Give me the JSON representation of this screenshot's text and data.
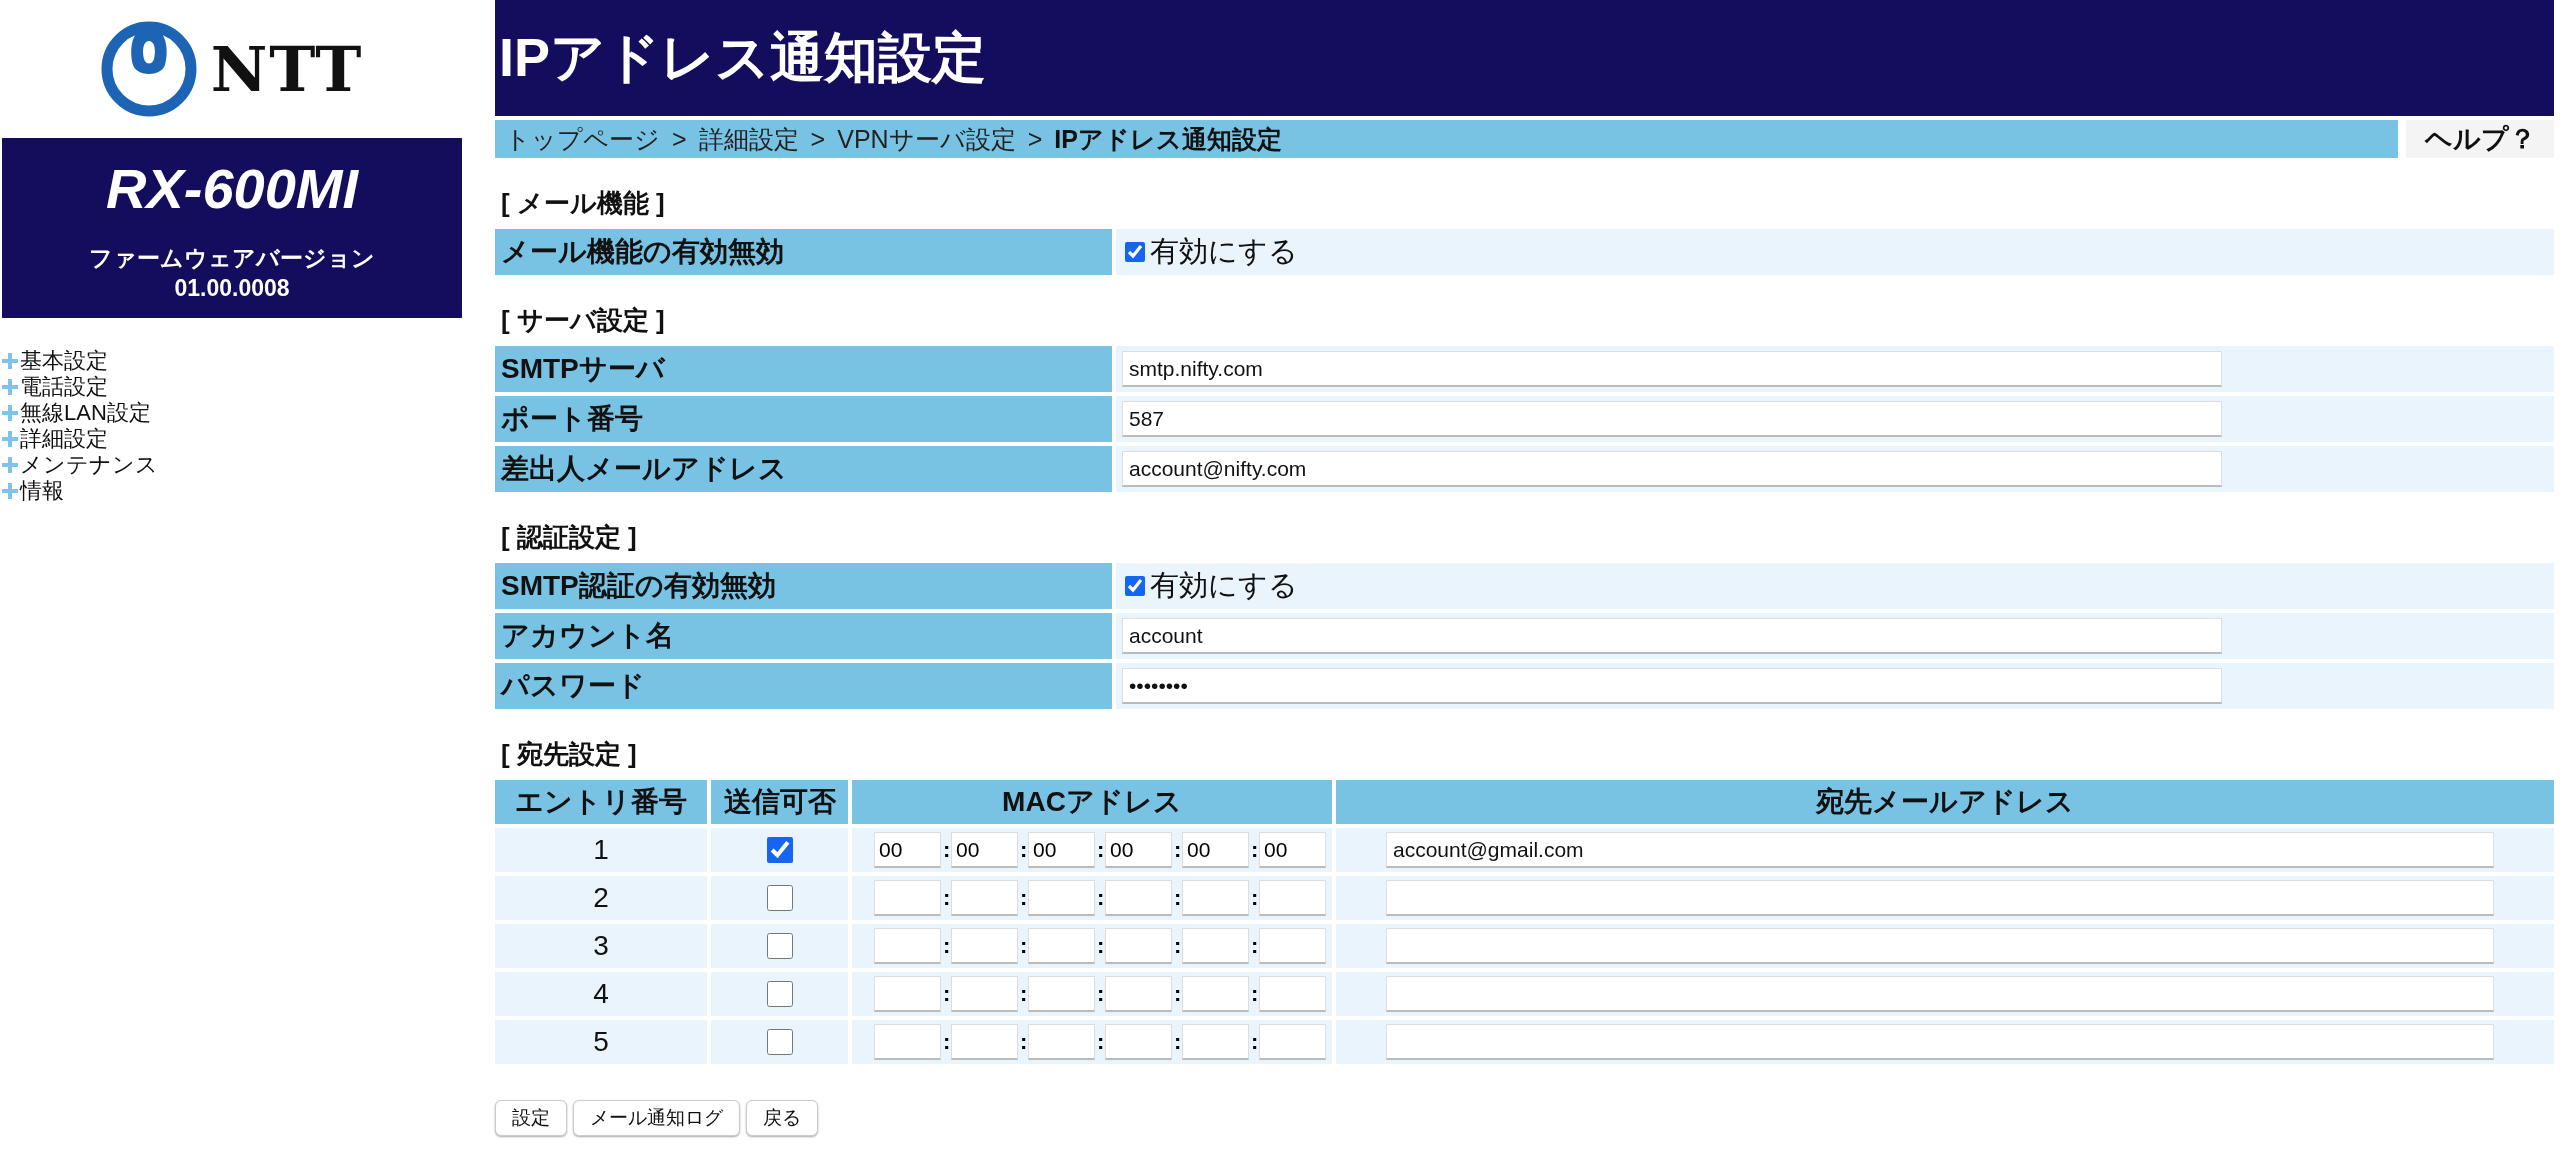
{
  "logo": {
    "text": "NTT"
  },
  "device": {
    "model": "RX-600MI",
    "firmware_label": "ファームウェアバージョン",
    "firmware_version": "01.00.0008"
  },
  "sidebar": {
    "items": [
      {
        "label": "基本設定"
      },
      {
        "label": "電話設定"
      },
      {
        "label": "無線LAN設定"
      },
      {
        "label": "詳細設定"
      },
      {
        "label": "メンテナンス"
      },
      {
        "label": "情報"
      }
    ]
  },
  "page_title": "IPアドレス通知設定",
  "breadcrumb": {
    "separator": ">",
    "items": [
      {
        "label": "トップページ",
        "current": false
      },
      {
        "label": "詳細設定",
        "current": false
      },
      {
        "label": "VPNサーバ設定",
        "current": false
      },
      {
        "label": "IPアドレス通知設定",
        "current": true
      }
    ]
  },
  "help_button": "ヘルプ？",
  "sections": [
    {
      "heading": "[ メール機能 ]",
      "rows": [
        {
          "kind": "checkbox",
          "label": "メール機能の有効無効",
          "checked": true,
          "option": "有効にする"
        }
      ]
    },
    {
      "heading": "[ サーバ設定 ]",
      "rows": [
        {
          "kind": "text",
          "label": "SMTPサーバ",
          "value": "smtp.nifty.com"
        },
        {
          "kind": "text",
          "label": "ポート番号",
          "value": "587"
        },
        {
          "kind": "text",
          "label": "差出人メールアドレス",
          "value": "account@nifty.com"
        }
      ]
    },
    {
      "heading": "[ 認証設定 ]",
      "rows": [
        {
          "kind": "checkbox",
          "label": "SMTP認証の有効無効",
          "checked": true,
          "option": "有効にする"
        },
        {
          "kind": "text",
          "label": "アカウント名",
          "value": "account"
        },
        {
          "kind": "password",
          "label": "パスワード",
          "value": "••••••••"
        }
      ]
    }
  ],
  "destinations": {
    "heading": "[ 宛先設定 ]",
    "columns": [
      "エントリ番号",
      "送信可否",
      "MACアドレス",
      "宛先メールアドレス"
    ],
    "mac_separator": ":",
    "rows": [
      {
        "entry": "1",
        "checked": true,
        "mac": [
          "00",
          "00",
          "00",
          "00",
          "00",
          "00"
        ],
        "email": "account@gmail.com"
      },
      {
        "entry": "2",
        "checked": false
      },
      {
        "entry": "3",
        "checked": false
      },
      {
        "entry": "4",
        "checked": false
      },
      {
        "entry": "5",
        "checked": false
      }
    ]
  },
  "buttons": [
    "設定",
    "メール通知ログ",
    "戻る"
  ]
}
